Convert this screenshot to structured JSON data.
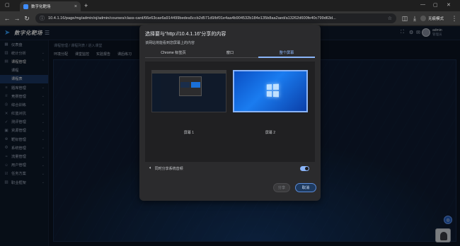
{
  "browser": {
    "tab_title": "数字化靶场",
    "url": "10.4.1.16/page/mg/admin/oj/admin/courses/class-card/66e63cae6a914499bedea5ccb2d571d9/bf01e4aa4b904532b184e135b8aa2aed/a13262d600fe40c799d63d...",
    "incognito_label": "无痕模式"
  },
  "app": {
    "logo": "数字化靶场",
    "user": {
      "name": "admin",
      "role": "管理员"
    },
    "breadcrumb": "课程管理  /  课程列表  /  进入课堂",
    "subtabs": [
      "环境分配",
      "课堂监控",
      "实验报告",
      "课后练习"
    ],
    "sidebar": [
      {
        "label": "仪表盘",
        "icon": "dashboard-icon",
        "state": "normal"
      },
      {
        "label": "统计分析",
        "icon": "chart-icon",
        "state": "normal"
      },
      {
        "label": "课程管理",
        "icon": "book-icon",
        "state": "open"
      },
      {
        "label": "课程",
        "icon": "",
        "state": "sub"
      },
      {
        "label": "课程表",
        "icon": "",
        "state": "active"
      },
      {
        "label": "题库管理",
        "icon": "list-icon",
        "state": "normal"
      },
      {
        "label": "竞赛管理",
        "icon": "trophy-icon",
        "state": "normal"
      },
      {
        "label": "综合训练",
        "icon": "target-icon",
        "state": "normal"
      },
      {
        "label": "红蓝对抗",
        "icon": "swords-icon",
        "state": "normal"
      },
      {
        "label": "测评管理",
        "icon": "check-icon",
        "state": "normal"
      },
      {
        "label": "资源管理",
        "icon": "box-icon",
        "state": "normal"
      },
      {
        "label": "靶标管理",
        "icon": "crosshair-icon",
        "state": "normal"
      },
      {
        "label": "系统管理",
        "icon": "gear-icon",
        "state": "normal"
      },
      {
        "label": "流量管理",
        "icon": "flow-icon",
        "state": "normal"
      },
      {
        "label": "用户管理",
        "icon": "user-icon",
        "state": "normal"
      },
      {
        "label": "任务方案",
        "icon": "task-icon",
        "state": "normal"
      },
      {
        "label": "职业框架",
        "icon": "frame-icon",
        "state": "normal"
      }
    ]
  },
  "dialog": {
    "title": "选择要与“http://10.4.1.16”分享的内容",
    "subtitle": "该网站将能看到您屏幕上的内容",
    "tabs": [
      "Chrome 标签页",
      "窗口",
      "整个屏幕"
    ],
    "selected_tab": "整个屏幕",
    "screens": [
      {
        "label": "屏幕 1",
        "selected": false
      },
      {
        "label": "屏幕 2",
        "selected": true
      }
    ],
    "audio_label": "同时分享系统音频",
    "audio_enabled": true,
    "share_label": "分享",
    "cancel_label": "取消"
  }
}
